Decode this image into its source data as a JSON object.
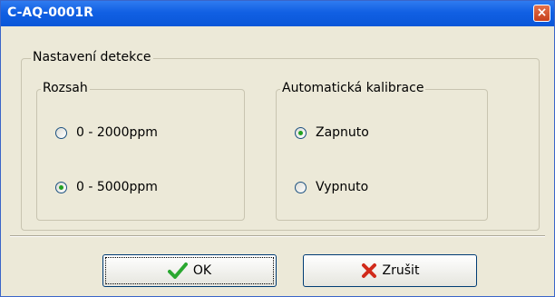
{
  "window": {
    "title": "C-AQ-0001R",
    "close_label": "×"
  },
  "detection_group": {
    "label": "Nastavení detekce"
  },
  "range_group": {
    "label": "Rozsah",
    "options": [
      {
        "label": "0 - 2000ppm",
        "checked": false
      },
      {
        "label": "0 - 5000ppm",
        "checked": true
      }
    ]
  },
  "calibration_group": {
    "label": "Automatická kalibrace",
    "options": [
      {
        "label": "Zapnuto",
        "checked": true
      },
      {
        "label": "Vypnuto",
        "checked": false
      }
    ]
  },
  "buttons": {
    "ok_label": "OK",
    "cancel_label": "Zrušit"
  },
  "colors": {
    "titlebar": "#0a56d8",
    "ok_check": "#2aa830",
    "cancel_x": "#d12a1a"
  }
}
